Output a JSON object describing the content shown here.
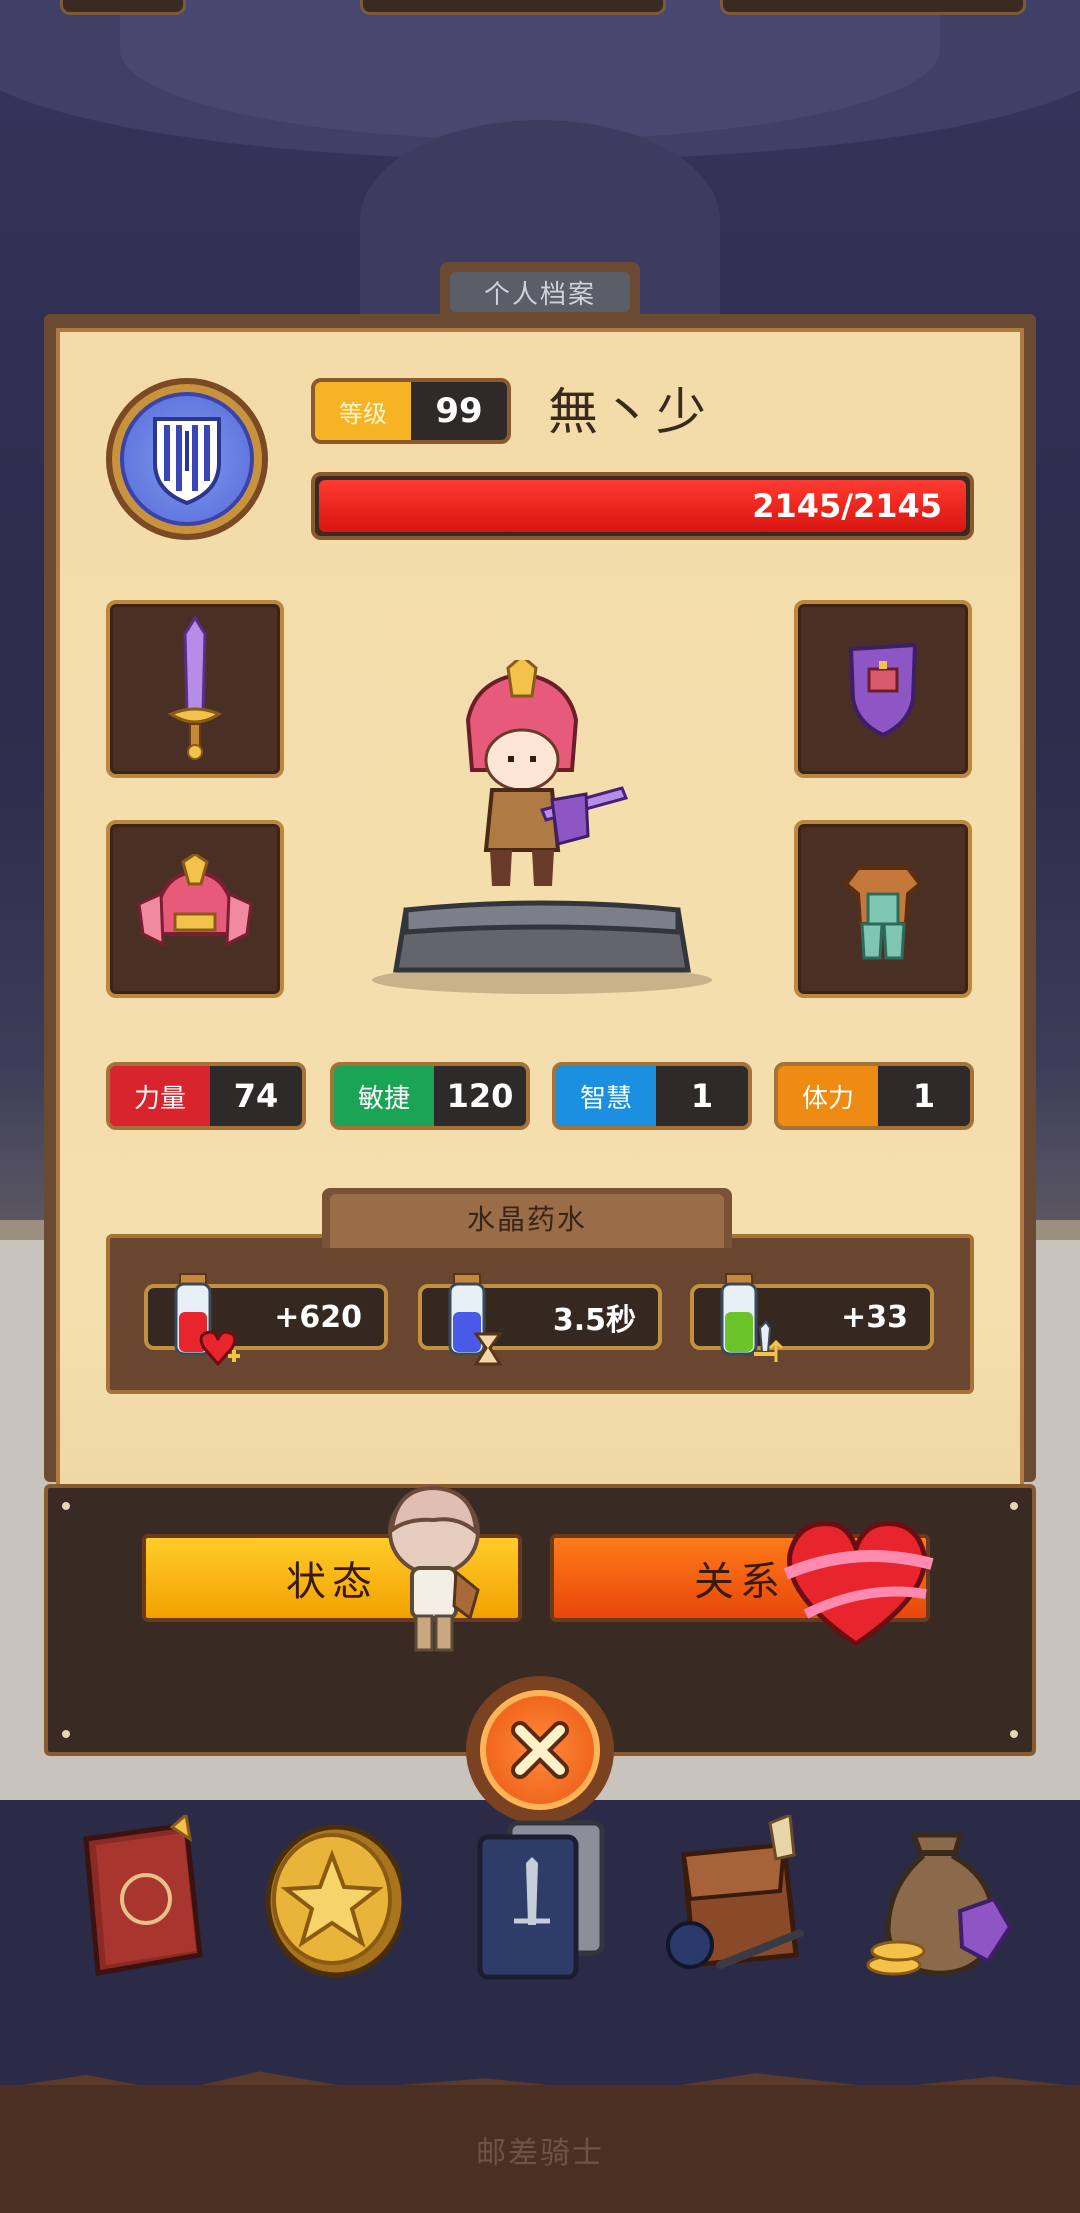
{
  "profile": {
    "tab_title": "个人档案",
    "level_label": "等级",
    "level": "99",
    "player_name": "無丶少",
    "hp": "2145/2145"
  },
  "stats": [
    {
      "label": "力量",
      "value": "74",
      "color": "#d8242c"
    },
    {
      "label": "敏捷",
      "value": "120",
      "color": "#1aa455"
    },
    {
      "label": "智慧",
      "value": "1",
      "color": "#1b8fe0"
    },
    {
      "label": "体力",
      "value": "1",
      "color": "#ef8a12"
    }
  ],
  "potions": {
    "title": "水晶药水",
    "items": [
      {
        "value": "+620",
        "icon": "health-potion-icon"
      },
      {
        "value": "3.5秒",
        "icon": "speed-potion-icon"
      },
      {
        "value": "+33",
        "icon": "attack-potion-icon"
      }
    ]
  },
  "buttons": {
    "status": "状态",
    "relation": "关系"
  },
  "bottom_label": "邮差骑士",
  "equipment": [
    "sword",
    "shield",
    "helmet",
    "armor"
  ],
  "nav": [
    "book",
    "coin",
    "card-deck",
    "backpack",
    "treasure-bag"
  ]
}
